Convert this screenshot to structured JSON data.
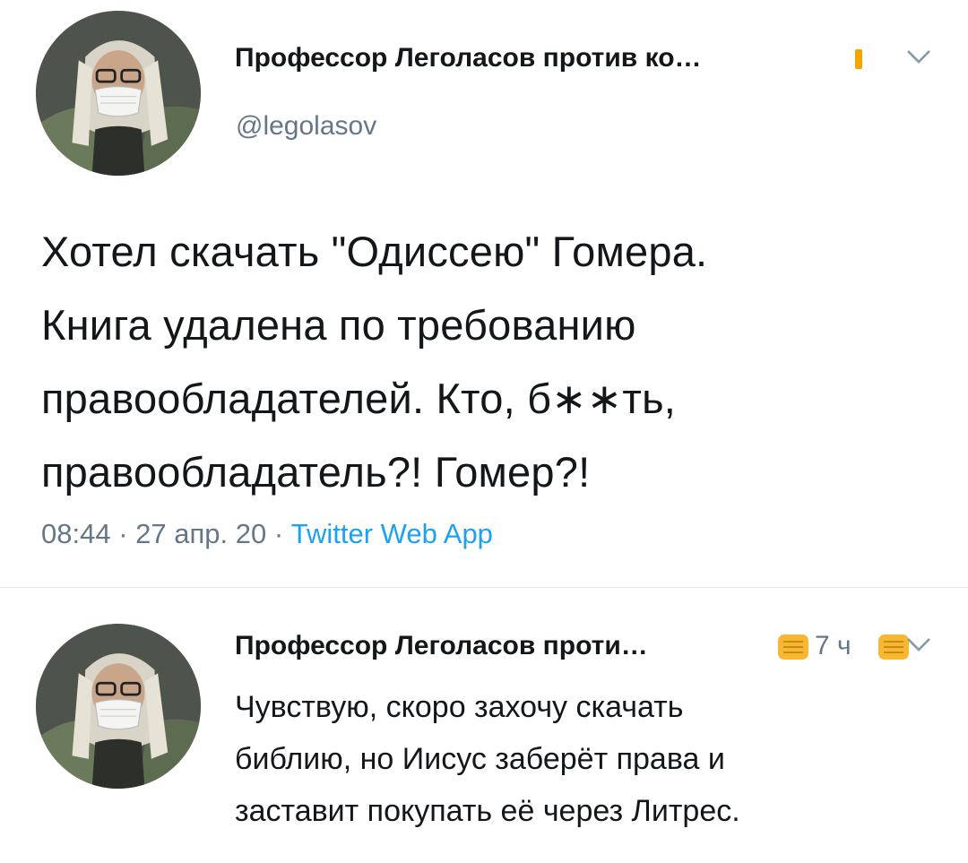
{
  "main_tweet": {
    "author_name": "Профессор Леголасов против ко…",
    "handle": "@legolasov",
    "text_lines": [
      "Хотел скачать \"Одиссею\" Гомера.",
      "Книга удалена по требованию",
      "правообладателей. Кто, б∗∗ть,",
      "правообладатель?! Гомер?!"
    ],
    "time": "08:44",
    "date": "27 апр. 20",
    "source": "Twitter Web App",
    "separator": " · "
  },
  "reply_tweet": {
    "author_name": "Профессор Леголасов проти…",
    "time_ago": "7 ч",
    "text_lines": [
      "Чувствую, скоро захочу скачать",
      "библию, но Иисус заберёт права и",
      "заставит покупать её через Литрес."
    ]
  },
  "icons": {
    "avatar": "masked-man-avatar",
    "more_menu": "chevron-down-icon",
    "emoji": "fist-emoji-icon"
  },
  "colors": {
    "text": "#14171a",
    "secondary": "#657786",
    "link": "#1da1f2",
    "divider": "#e1e8ed",
    "emoji": "#f7b733"
  }
}
